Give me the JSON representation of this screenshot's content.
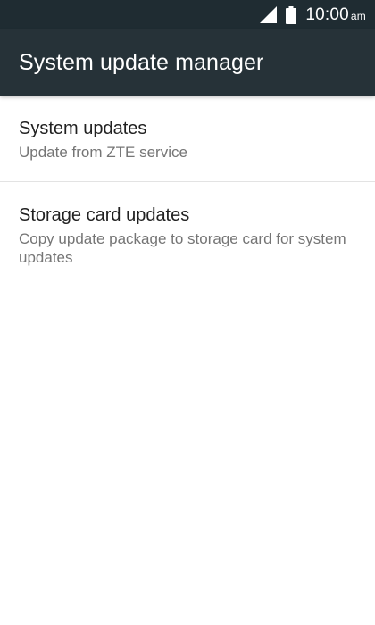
{
  "status_bar": {
    "time": "10:00",
    "ampm": "am",
    "icons": [
      "signal-icon",
      "battery-icon"
    ]
  },
  "app_bar": {
    "title": "System update manager"
  },
  "list": {
    "items": [
      {
        "title": "System updates",
        "subtitle": "Update from ZTE service"
      },
      {
        "title": "Storage card updates",
        "subtitle": "Copy update package to storage card for system updates"
      }
    ]
  },
  "colors": {
    "status_bar": "#1f2c32",
    "app_bar": "#263238",
    "title_text": "#212121",
    "subtitle_text": "#757575",
    "divider": "#e3e3e3"
  }
}
